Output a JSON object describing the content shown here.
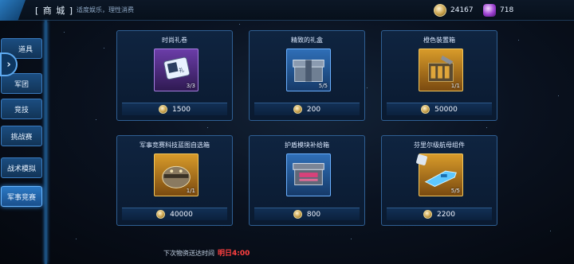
{
  "header": {
    "shop_title": "[ 商 城 ]",
    "notice": "适度娱乐，理性消费",
    "currency_coin": "24167",
    "currency_gem": "718"
  },
  "sidebar": {
    "items": [
      {
        "label": "道具"
      },
      {
        "label": "军团"
      },
      {
        "label": "竞技"
      },
      {
        "label": "挑战赛"
      },
      {
        "label": "战术模拟"
      },
      {
        "label": "军事竞赛"
      }
    ],
    "active_index": 5
  },
  "items": [
    {
      "name": "时尚礼卷",
      "stock": "3/3",
      "price": "1500",
      "rarity": "purple"
    },
    {
      "name": "精致的礼盒",
      "stock": "5/5",
      "price": "200",
      "rarity": "blue"
    },
    {
      "name": "橙色装置箱",
      "stock": "1/1",
      "price": "50000",
      "rarity": "orange"
    },
    {
      "name": "军事竞赛科技蓝图自选箱",
      "stock": "1/1",
      "price": "40000",
      "rarity": "orange"
    },
    {
      "name": "护盾模块补给箱",
      "stock": "",
      "price": "800",
      "rarity": "blue"
    },
    {
      "name": "芬里尔级航母组件",
      "stock": "5/5",
      "price": "2200",
      "rarity": "orange"
    }
  ],
  "footer": {
    "label": "下次物资送达时间",
    "time": "明日4:00"
  },
  "colors": {
    "accent": "#2f8de8",
    "timer": "#ff4040"
  },
  "icons": [
    "chevron-back-icon",
    "coin-icon",
    "gem-icon",
    "medal-price-icon"
  ]
}
